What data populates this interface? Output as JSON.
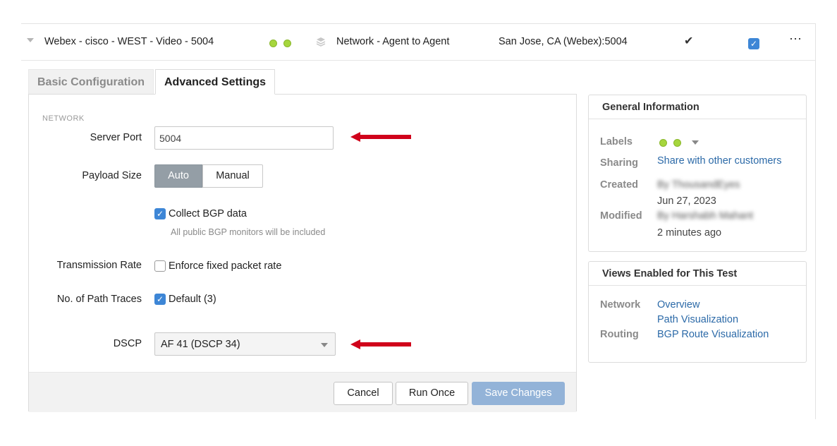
{
  "test_row": {
    "name": "Webex - cisco - WEST - Video - 5004",
    "type": "Network - Agent to Agent",
    "target": "San Jose, CA (Webex):5004",
    "status_colors": [
      "#a6d63d",
      "#a6d63d"
    ]
  },
  "tabs": [
    {
      "label": "Basic Configuration",
      "active": false
    },
    {
      "label": "Advanced Settings",
      "active": true
    }
  ],
  "network": {
    "section_title": "NETWORK",
    "server_port": {
      "label": "Server Port",
      "value": "5004"
    },
    "payload_size": {
      "label": "Payload Size",
      "options": [
        "Auto",
        "Manual"
      ],
      "selected": "Auto"
    },
    "collect_bgp": {
      "label": "Collect BGP data",
      "checked": true,
      "hint": "All public BGP monitors will be included"
    },
    "transmission_rate": {
      "label": "Transmission Rate",
      "option_label": "Enforce fixed packet rate",
      "checked": false
    },
    "path_traces": {
      "label": "No. of Path Traces",
      "option_label": "Default (3)",
      "checked": true
    },
    "dscp": {
      "label": "DSCP",
      "value": "AF 41 (DSCP 34)"
    }
  },
  "actions": {
    "cancel": "Cancel",
    "run_once": "Run Once",
    "save": "Save Changes"
  },
  "general_info": {
    "title": "General Information",
    "labels_key": "Labels",
    "sharing_key": "Sharing",
    "sharing_link": "Share with other customers",
    "created_key": "Created",
    "created_by": "By ThousandEyes",
    "created_date": "Jun 27, 2023",
    "modified_key": "Modified",
    "modified_by": "By Harshabh Mahant",
    "modified_time": "2 minutes ago"
  },
  "views": {
    "title": "Views Enabled for This Test",
    "network_key": "Network",
    "network_links": [
      "Overview",
      "Path Visualization"
    ],
    "routing_key": "Routing",
    "routing_links": [
      "BGP Route Visualization"
    ]
  },
  "colors": {
    "accent": "#3d86d6",
    "link": "#2c6aa8",
    "arrow": "#d0021b",
    "save_disabled": "#93b3d8"
  }
}
